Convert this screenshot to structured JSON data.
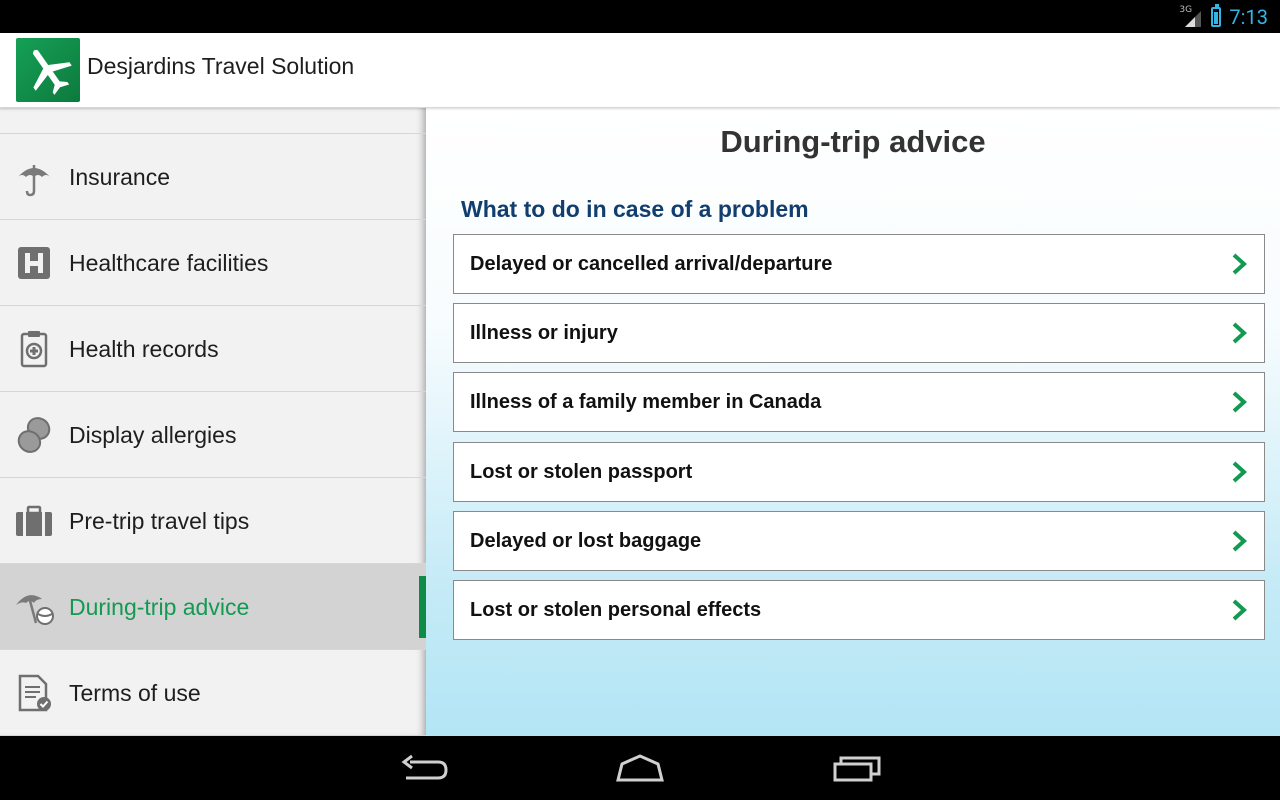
{
  "status_bar": {
    "network": "3G",
    "time": "7:13"
  },
  "app": {
    "title": "Desjardins Travel Solution",
    "logo_icon": "airplane-icon"
  },
  "drawer": {
    "items": [
      {
        "label": "Insurance",
        "icon": "umbrella-icon",
        "active": false
      },
      {
        "label": "Healthcare facilities",
        "icon": "hospital-icon",
        "active": false
      },
      {
        "label": "Health records",
        "icon": "clipboard-icon",
        "active": false
      },
      {
        "label": "Display allergies",
        "icon": "peanut-icon",
        "active": false
      },
      {
        "label": "Pre-trip travel tips",
        "icon": "suitcase-icon",
        "active": false
      },
      {
        "label": "During-trip advice",
        "icon": "beach-umbrella-icon",
        "active": true
      },
      {
        "label": "Terms of use",
        "icon": "document-check-icon",
        "active": false
      }
    ]
  },
  "main": {
    "title": "During-trip advice",
    "section_heading": "What to do in case of a problem",
    "items": [
      {
        "label": "Delayed or cancelled arrival/departure"
      },
      {
        "label": "Illness or injury"
      },
      {
        "label": "Illness of a family member in Canada"
      },
      {
        "label": "Lost or stolen passport"
      },
      {
        "label": "Delayed or lost baggage"
      },
      {
        "label": "Lost or stolen personal effects"
      }
    ]
  },
  "colors": {
    "accent_green": "#139a52",
    "heading_blue": "#123e6f",
    "status_blue": "#33b5e5"
  }
}
